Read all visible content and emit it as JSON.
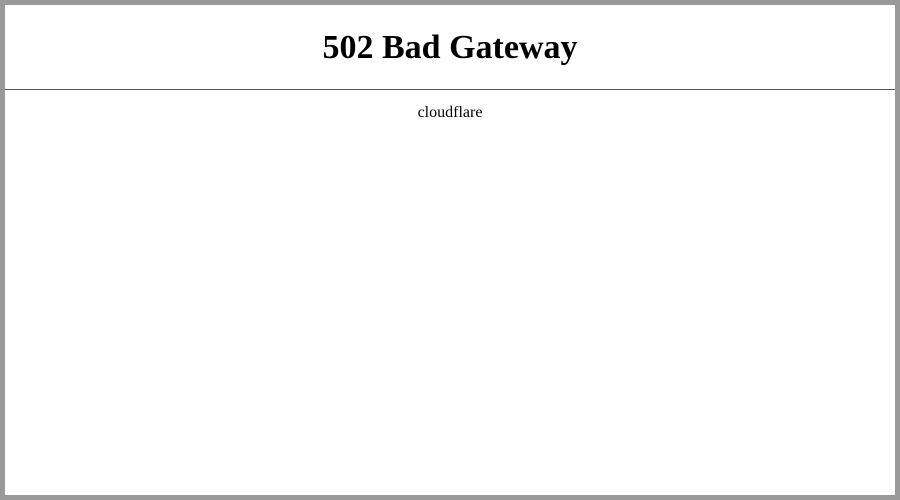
{
  "error": {
    "heading": "502 Bad Gateway",
    "provider": "cloudflare"
  }
}
